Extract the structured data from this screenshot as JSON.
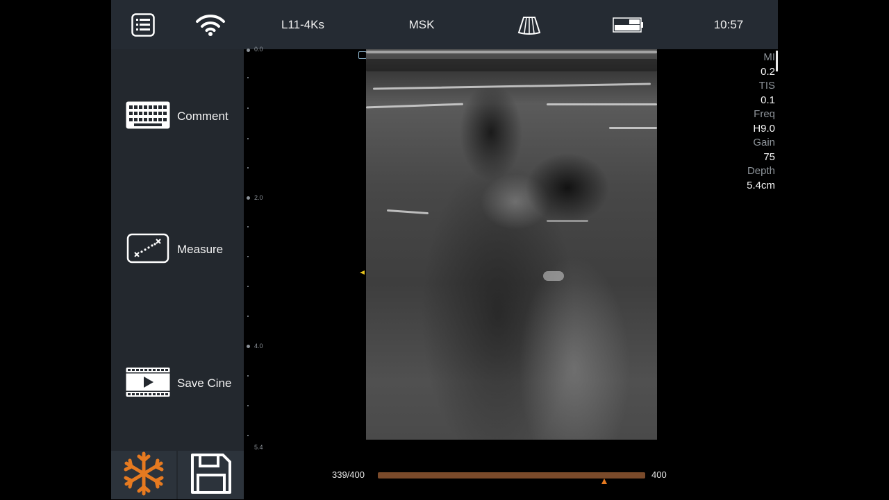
{
  "topbar": {
    "menu_icon": "list-menu-icon",
    "wifi_icon": "wifi-icon",
    "probe": "L11-4Ks",
    "preset": "MSK",
    "probe_icon": "probe-sector-icon",
    "battery_icon": "battery-icon",
    "time": "10:57"
  },
  "sidebar": {
    "comment_label": "Comment",
    "measure_label": "Measure",
    "save_cine_label": "Save Cine",
    "freeze_icon": "snowflake-icon",
    "save_icon": "floppy-disk-icon"
  },
  "ruler": {
    "labels": [
      "0.0",
      "2.0",
      "4.0",
      "5.4"
    ]
  },
  "params": {
    "mi_label": "MI",
    "mi_value": "0.2",
    "tis_label": "TIS",
    "tis_value": "0.1",
    "freq_label": "Freq",
    "freq_value": "H9.0",
    "gain_label": "Gain",
    "gain_value": "75",
    "depth_label": "Depth",
    "depth_value": "5.4cm"
  },
  "cine": {
    "frame_text": "339/400",
    "total_text": "400",
    "position_fraction": 0.8475
  },
  "colors": {
    "topbar_bg": "#252b33",
    "sidebar_bg": "#23282e",
    "freeze_accent": "#e67a20",
    "cine_track": "#7a4a2a"
  }
}
